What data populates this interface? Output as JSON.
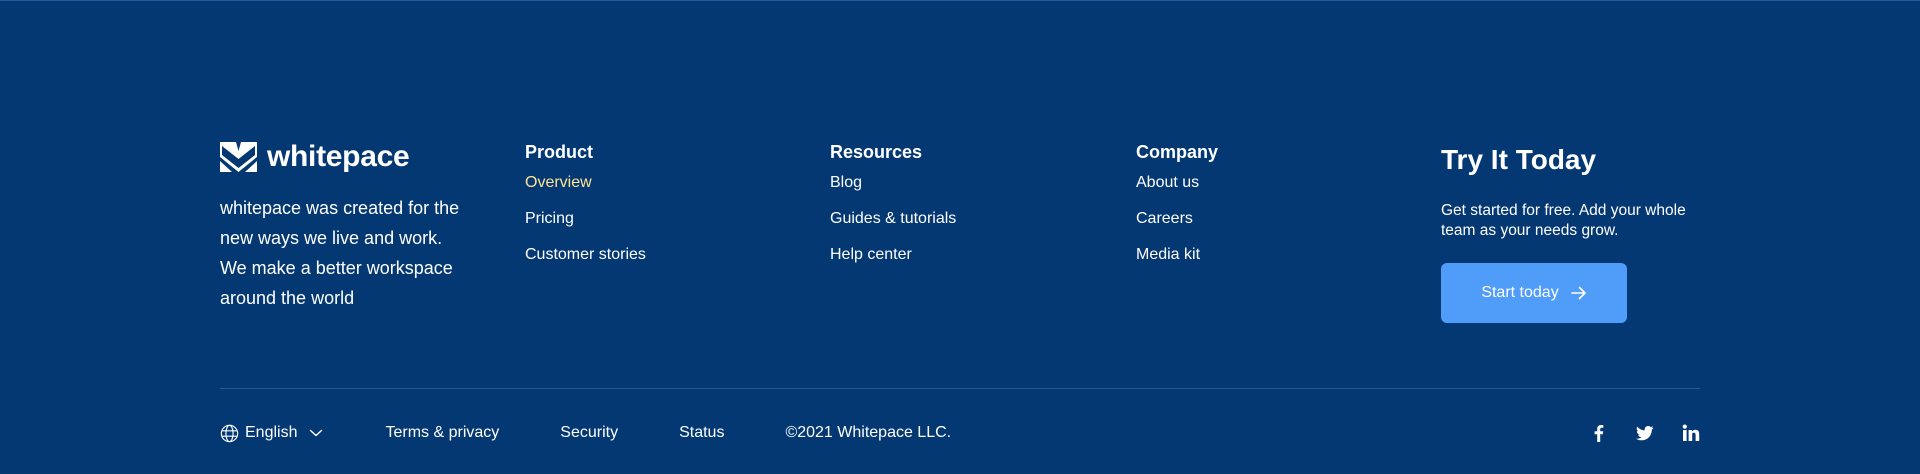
{
  "brand": {
    "name": "whitepace",
    "tagline": "whitepace was created for the new ways we live and work. We make a better workspace around the world"
  },
  "columns": [
    {
      "title": "Product",
      "links": [
        "Overview",
        "Pricing",
        "Customer stories"
      ]
    },
    {
      "title": "Resources",
      "links": [
        "Blog",
        "Guides & tutorials",
        "Help center"
      ]
    },
    {
      "title": "Company",
      "links": [
        "About us",
        "Careers",
        "Media kit"
      ]
    }
  ],
  "cta": {
    "title": "Try It Today",
    "text": "Get started for free. Add your whole team as your needs grow.",
    "button_label": "Start today",
    "button_icon": "arrow-right-icon"
  },
  "bottom": {
    "language": "English",
    "language_icon": "globe-icon",
    "terms": "Terms & privacy",
    "security": "Security",
    "status": "Status",
    "copyright": "©2021 Whitepace LLC."
  },
  "socials": [
    "facebook-icon",
    "twitter-icon",
    "linkedin-icon"
  ],
  "colors": {
    "background": "#043873",
    "accent_link": "#FFE492",
    "button": "#4F9CF9",
    "divider": "#2A5689"
  }
}
